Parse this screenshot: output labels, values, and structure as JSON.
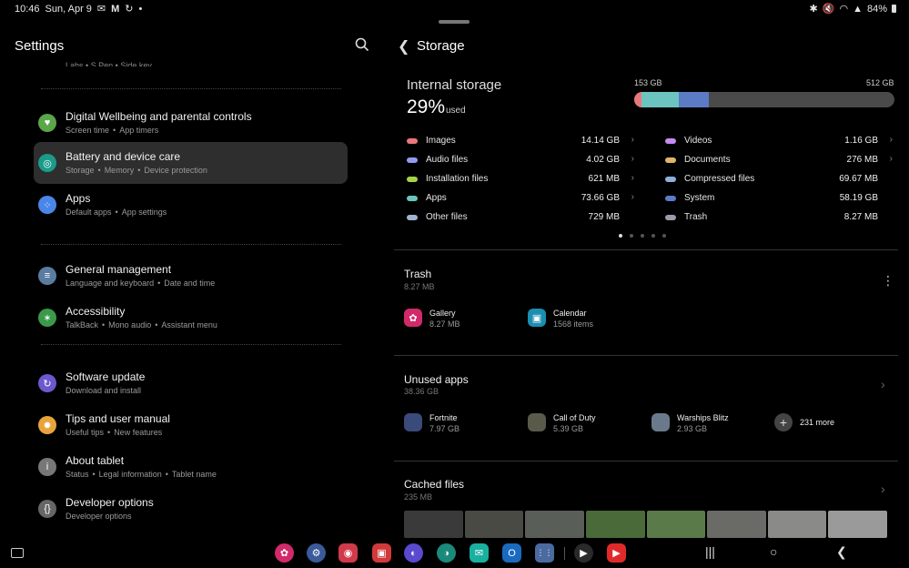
{
  "status_bar": {
    "time": "10:46",
    "date": "Sun, Apr 9",
    "notification_icons": [
      "mail-icon",
      "gmail-icon",
      "sync-icon"
    ],
    "dot": "•",
    "battery": "84%"
  },
  "settings": {
    "title": "Settings",
    "cut_item_subtitle": "Labs  •  S Pen  •  Side key",
    "items": [
      {
        "title": "Digital Wellbeing and parental controls",
        "sub": [
          "Screen time",
          "App timers"
        ],
        "color": "#5aa64a",
        "icon": "wellbeing-icon"
      },
      {
        "title": "Battery and device care",
        "sub": [
          "Storage",
          "Memory",
          "Device protection"
        ],
        "color": "#1b9b8a",
        "icon": "device-care-icon"
      },
      {
        "title": "Apps",
        "sub": [
          "Default apps",
          "App settings"
        ],
        "color": "#4a86e8",
        "icon": "apps-grid-icon"
      },
      {
        "title": "General management",
        "sub": [
          "Language and keyboard",
          "Date and time"
        ],
        "color": "#5b7ca0",
        "icon": "sliders-icon"
      },
      {
        "title": "Accessibility",
        "sub": [
          "TalkBack",
          "Mono audio",
          "Assistant menu"
        ],
        "color": "#3a9a4a",
        "icon": "accessibility-icon"
      },
      {
        "title": "Software update",
        "sub": [
          "Download and install"
        ],
        "color": "#6a5acd",
        "icon": "update-icon"
      },
      {
        "title": "Tips and user manual",
        "sub": [
          "Useful tips",
          "New features"
        ],
        "color": "#e8a33a",
        "icon": "lightbulb-icon"
      },
      {
        "title": "About tablet",
        "sub": [
          "Status",
          "Legal information",
          "Tablet name"
        ],
        "color": "#777777",
        "icon": "info-icon"
      },
      {
        "title": "Developer options",
        "sub": [
          "Developer options"
        ],
        "color": "#666666",
        "icon": "braces-icon"
      }
    ]
  },
  "storage": {
    "title": "Storage",
    "internal_label": "Internal storage",
    "percent": "29%",
    "used_word": "used",
    "used_gb": "153 GB",
    "total_gb": "512 GB",
    "bar_segments": [
      {
        "name": "Images",
        "fraction": 0.0276,
        "color": "#e8787a"
      },
      {
        "name": "Apps",
        "fraction": 0.1439,
        "color": "#6cc4c0"
      },
      {
        "name": "System",
        "fraction": 0.1137,
        "color": "#5b7bc4"
      }
    ],
    "categories_left": [
      {
        "name": "Images",
        "value": "14.14 GB",
        "color": "#e8787a",
        "chevron": true
      },
      {
        "name": "Audio files",
        "value": "4.02 GB",
        "color": "#8f9cf0",
        "chevron": true
      },
      {
        "name": "Installation files",
        "value": "621 MB",
        "color": "#a6d24a",
        "chevron": true
      },
      {
        "name": "Apps",
        "value": "73.66 GB",
        "color": "#6cc4c0",
        "chevron": true
      },
      {
        "name": "Other files",
        "value": "729 MB",
        "color": "#9fb4d0",
        "chevron": false
      }
    ],
    "categories_right": [
      {
        "name": "Videos",
        "value": "1.16 GB",
        "color": "#c68af0",
        "chevron": true
      },
      {
        "name": "Documents",
        "value": "276 MB",
        "color": "#e0b46a",
        "chevron": true
      },
      {
        "name": "Compressed files",
        "value": "69.67 MB",
        "color": "#8eb0d8",
        "chevron": false
      },
      {
        "name": "System",
        "value": "58.19 GB",
        "color": "#5b7bc4",
        "chevron": false
      },
      {
        "name": "Trash",
        "value": "8.27 MB",
        "color": "#9a9aaa",
        "chevron": false
      }
    ],
    "pager_pages": 5,
    "pager_active": 0,
    "trash": {
      "title": "Trash",
      "size": "8.27 MB",
      "apps": [
        {
          "name": "Gallery",
          "detail": "8.27 MB",
          "color": "#d12a6a"
        },
        {
          "name": "Calendar",
          "detail": "1568 items",
          "color": "#1a8fb0"
        }
      ]
    },
    "unused": {
      "title": "Unused apps",
      "size": "38.36 GB",
      "apps": [
        {
          "name": "Fortnite",
          "detail": "7.97 GB",
          "color": "#3a4a7a"
        },
        {
          "name": "Call of Duty",
          "detail": "5.39 GB",
          "color": "#5a5a4a"
        },
        {
          "name": "Warships Blitz",
          "detail": "2.93 GB",
          "color": "#6a7a8a"
        }
      ],
      "more": "231 more"
    },
    "cached": {
      "title": "Cached files",
      "size": "235 MB",
      "thumb_colors": [
        "#3a3a3a",
        "#4a4a44",
        "#5a5e58",
        "#4a6a3a",
        "#5a7a4a",
        "#6a6a66",
        "#8a8a88",
        "#9a9a9a"
      ]
    }
  },
  "dock": {
    "apps": [
      {
        "name": "gallery-app-icon",
        "color": "#d12a6a",
        "glyph": "✿"
      },
      {
        "name": "settings-app-icon",
        "color": "#3a5a9a",
        "glyph": "⚙"
      },
      {
        "name": "camera-app-icon",
        "color": "#d03a4a",
        "glyph": "◉"
      },
      {
        "name": "screen-recorder-app-icon",
        "color": "#d03a3a",
        "glyph": "▣"
      },
      {
        "name": "internet-app-icon",
        "color": "#5a4ad0",
        "glyph": "◐"
      },
      {
        "name": "edge-app-icon",
        "color": "#1a8a7a",
        "glyph": "◑"
      },
      {
        "name": "email-app-icon",
        "color": "#1ab0a0",
        "glyph": "✉"
      },
      {
        "name": "outlook-app-icon",
        "color": "#1a6ac0",
        "glyph": "O"
      },
      {
        "name": "app-drawer-icon",
        "color": "#4a6aa0",
        "glyph": "⋮⋮"
      },
      {
        "name": "play-store-app-icon",
        "color": "#2a2a2a",
        "glyph": "▶"
      },
      {
        "name": "youtube-app-icon",
        "color": "#e02a2a",
        "glyph": "▶"
      }
    ]
  }
}
